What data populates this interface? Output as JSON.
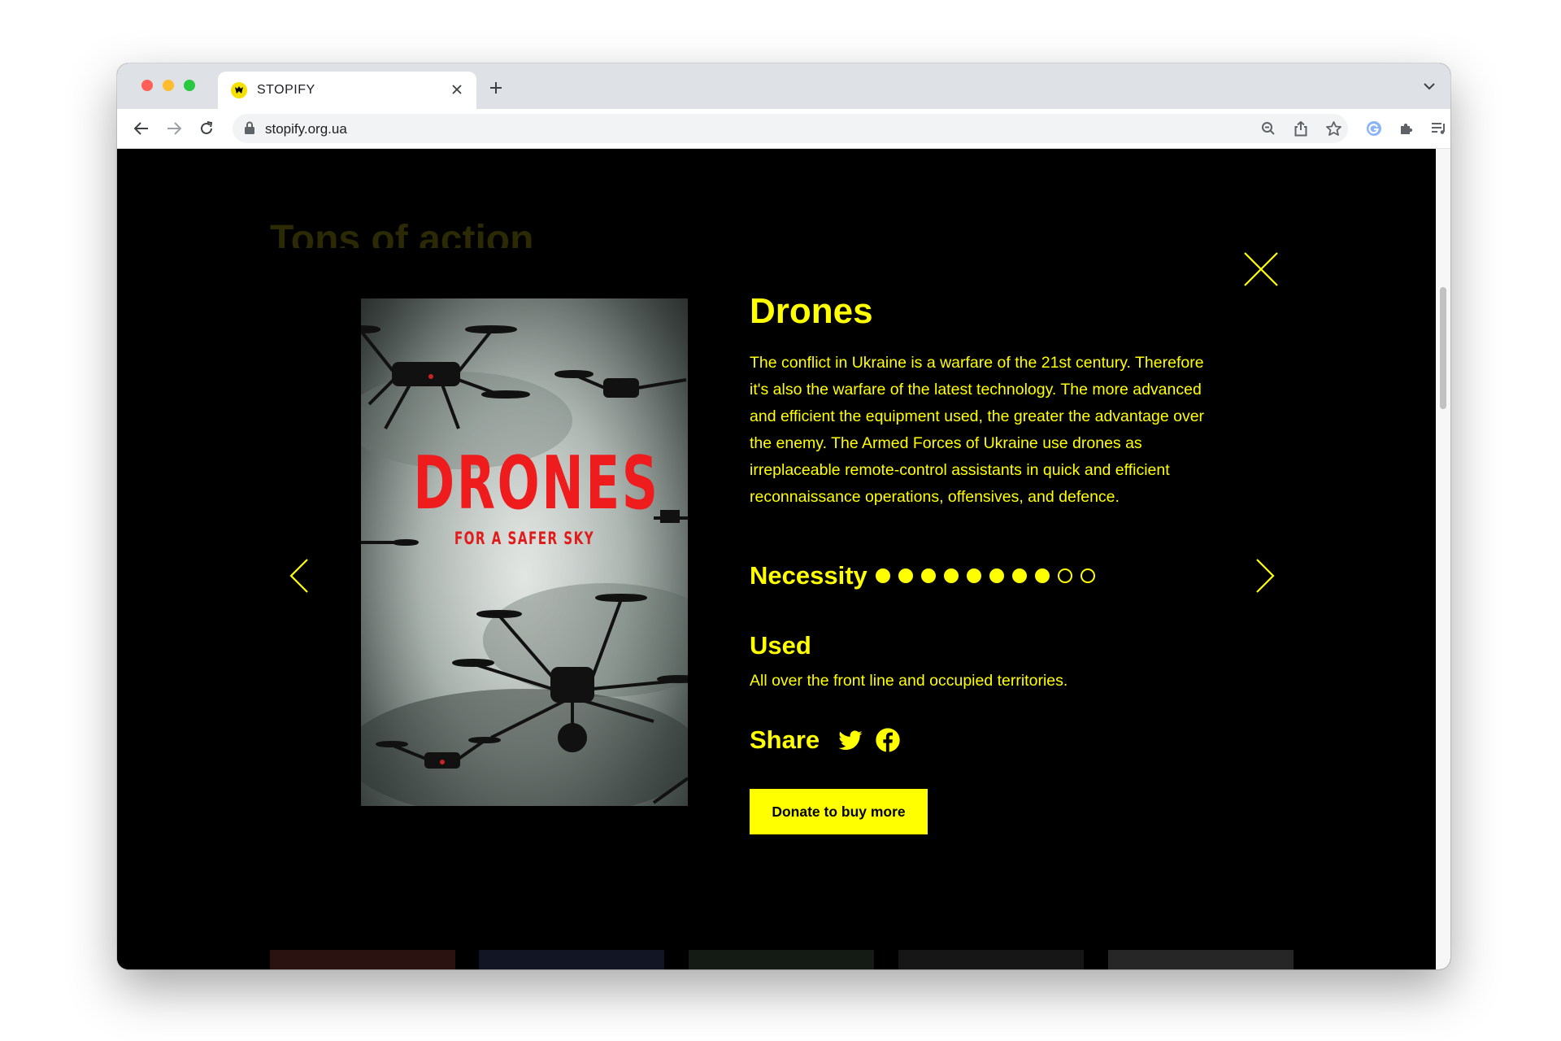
{
  "browser": {
    "tab_title": "STOPIFY",
    "url": "stopify.org.ua"
  },
  "page": {
    "background_heading": "Tons of action"
  },
  "modal": {
    "title": "Drones",
    "description": "The conflict in Ukraine is a warfare of the 21st century. Therefore it's also the warfare of the latest technology. The more advanced and efficient the equipment used, the greater the advantage over the enemy. The Armed Forces of Ukraine use drones as irreplaceable remote-control assistants in quick and efficient reconnaissance operations, offensives, and defence.",
    "poster": {
      "title": "DRONES",
      "tagline": "FOR A SAFER SKY"
    },
    "necessity": {
      "label": "Necessity",
      "rating": 8,
      "max": 10
    },
    "used": {
      "label": "Used",
      "text": "All over the front line and occupied territories."
    },
    "share": {
      "label": "Share"
    },
    "donate_label": "Donate to buy more"
  },
  "icons": [
    "close-icon",
    "chevron-left-icon",
    "chevron-right-icon",
    "twitter-icon",
    "facebook-icon"
  ],
  "colors": {
    "accent": "#ffff00",
    "background": "#000000",
    "poster_title": "#ee1c1c"
  }
}
